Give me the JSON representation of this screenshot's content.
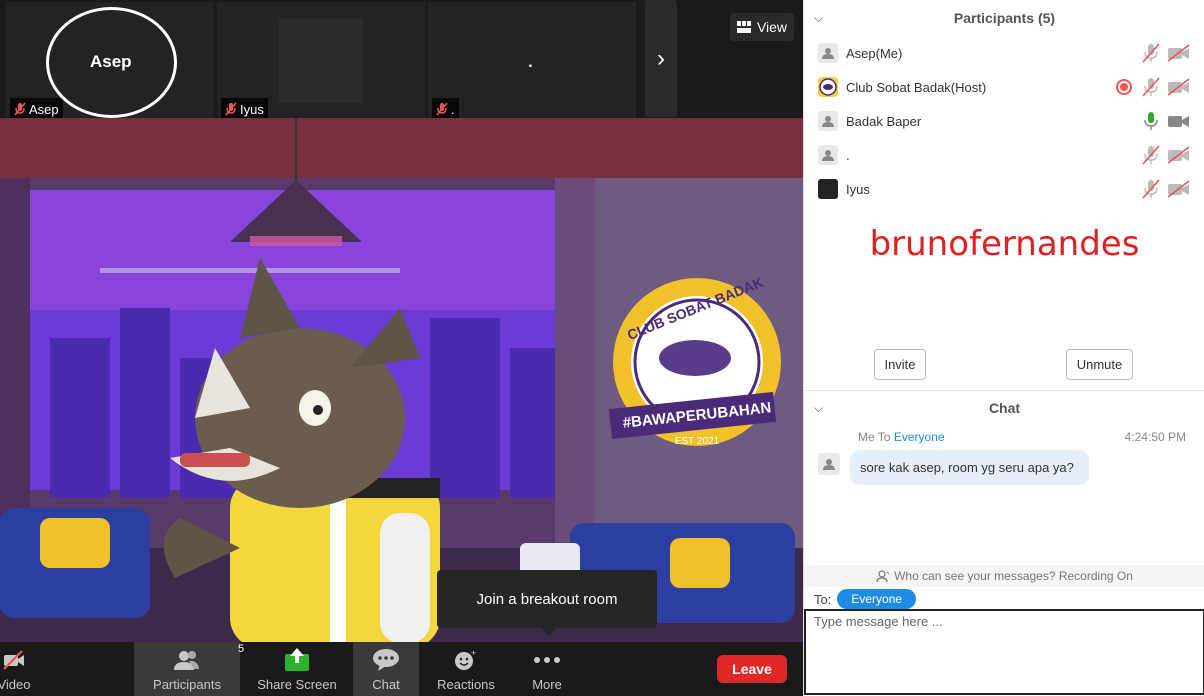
{
  "thumbnails": [
    {
      "name": "Asep",
      "label": "Asep",
      "muted": true
    },
    {
      "name": "",
      "label": "Iyus",
      "muted": true
    },
    {
      "name": ".",
      "label": ".",
      "muted": true
    }
  ],
  "view_button": {
    "label": "View"
  },
  "tooltip": {
    "text": "Join a breakout room"
  },
  "main_video": {
    "logo_text_top": "CLUB SOBAT BADAK",
    "logo_text_bottom": "#BAWAPERUBAHAN",
    "logo_est": "EST 2021"
  },
  "toolbar": {
    "video_label": "Video",
    "participants_label": "Participants",
    "participants_count": "5",
    "share_label": "Share Screen",
    "chat_label": "Chat",
    "reactions_label": "Reactions",
    "more_label": "More",
    "leave_label": "Leave"
  },
  "participants_panel": {
    "title": "Participants (5)",
    "participants": [
      {
        "name": "Asep(Me)",
        "mic": "muted",
        "cam": "off",
        "avatar": "person",
        "recording": false
      },
      {
        "name": "Club Sobat Badak(Host)",
        "mic": "muted",
        "cam": "off",
        "avatar": "logo",
        "recording": true
      },
      {
        "name": "Badak Baper",
        "mic": "active",
        "cam": "on",
        "avatar": "person",
        "recording": false
      },
      {
        "name": ".",
        "mic": "muted",
        "cam": "off",
        "avatar": "person",
        "recording": false
      },
      {
        "name": "Iyus",
        "mic": "muted",
        "cam": "off",
        "avatar": "dark",
        "recording": false
      }
    ],
    "invite_label": "Invite",
    "unmute_label": "Unmute"
  },
  "watermark": "brunofernandes",
  "chat_panel": {
    "title": "Chat",
    "messages": [
      {
        "from": "Me",
        "to_prefix": "To",
        "to": "Everyone",
        "time": "4:24:50 PM",
        "text": "sore kak asep, room yg seru apa ya?"
      }
    ],
    "privacy_text": "Who can see your messages? Recording On",
    "to_label": "To:",
    "to_recipient": "Everyone",
    "input_placeholder": "Type message here ..."
  },
  "colors": {
    "accent": "#1f8ce4",
    "leave": "#e02828",
    "recording": "#e55555",
    "share_green": "#2bb32b",
    "mic_active": "#2fa82f",
    "watermark": "#e02020"
  }
}
